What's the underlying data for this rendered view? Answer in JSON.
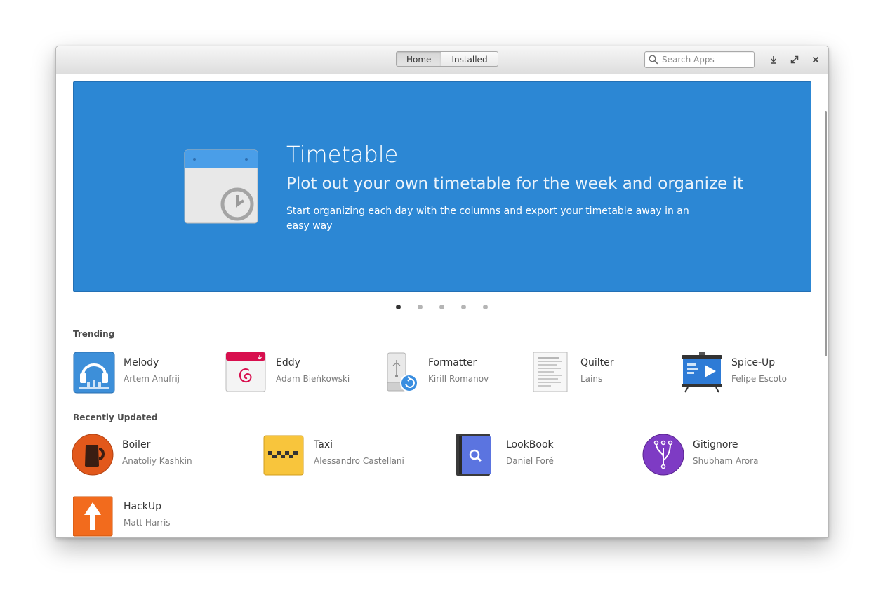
{
  "header": {
    "tabs": [
      {
        "label": "Home"
      },
      {
        "label": "Installed"
      }
    ],
    "search": {
      "placeholder": "Search Apps",
      "icon": "search-icon"
    },
    "buttons": [
      "download-icon",
      "maximize-icon",
      "close-icon"
    ]
  },
  "banner": {
    "title": "Timetable",
    "subtitle": "Plot out your own timetable for the week and organize it",
    "description": "Start organizing each day with the columns and export your timetable away in an easy way",
    "color": "#2c87d4",
    "icon": "calendar-clock-icon"
  },
  "carousel": {
    "count": 5,
    "active": 1
  },
  "trending": {
    "title": "Trending",
    "apps": [
      {
        "name": "Melody",
        "author": "Artem Anufrij",
        "icon": "headphones-icon"
      },
      {
        "name": "Eddy",
        "author": "Adam Bieńkowski",
        "icon": "debian-package-icon"
      },
      {
        "name": "Formatter",
        "author": "Kirill Romanov",
        "icon": "usb-drive-icon"
      },
      {
        "name": "Quilter",
        "author": "Lains",
        "icon": "document-icon"
      },
      {
        "name": "Spice-Up",
        "author": "Felipe Escoto",
        "icon": "presentation-icon"
      }
    ]
  },
  "recent": {
    "title": "Recently Updated",
    "apps": [
      {
        "name": "Boiler",
        "author": "Anatoliy Kashkin",
        "icon": "kettle-icon"
      },
      {
        "name": "Taxi",
        "author": "Alessandro Castellani",
        "icon": "taxi-icon"
      },
      {
        "name": "LookBook",
        "author": "Daniel Foré",
        "icon": "book-search-icon"
      },
      {
        "name": "Gitignore",
        "author": "Shubham Arora",
        "icon": "git-branch-icon"
      },
      {
        "name": "HackUp",
        "author": "Matt Harris",
        "icon": "arrow-up-icon"
      }
    ]
  }
}
